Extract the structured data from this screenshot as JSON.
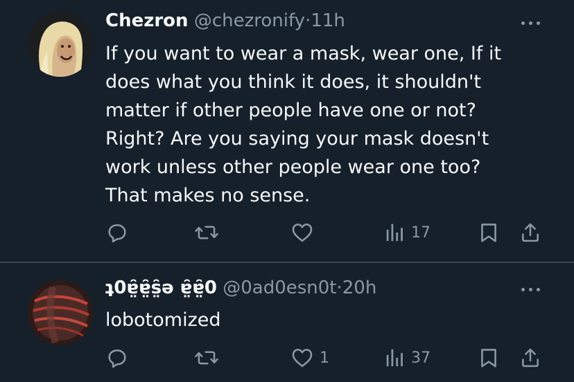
{
  "colors": {
    "background": "#15202b",
    "text_primary": "#f7f9f9",
    "text_secondary": "#8b98a5",
    "divider": "#38444d"
  },
  "tweets": [
    {
      "display_name": "Chezron",
      "handle": "@chezronify",
      "separator": "·",
      "time": "11h",
      "text": "If you want to wear a mask, wear one, If it\ndoes what you think it does, it shouldn't\nmatter if other people have one or not?\nRight? Are you saying your mask doesn't\nwork unless other people wear one too?\nThat makes no sense.",
      "reply_count": "",
      "retweet_count": "",
      "like_count": "",
      "view_count": "17",
      "icons": [
        "reply-icon",
        "retweet-icon",
        "like-icon",
        "views-icon",
        "bookmark-icon",
        "share-icon",
        "more-icon"
      ]
    },
    {
      "display_name": "ʇ0ɐ̤̑ɐ̤̑s̤̑ǝ ɐ̤̑ɐ̤̑0",
      "handle": "@0ad0esn0t",
      "separator": "·",
      "time": "20h",
      "text": "lobotomized",
      "reply_count": "",
      "retweet_count": "",
      "like_count": "1",
      "view_count": "37",
      "icons": [
        "reply-icon",
        "retweet-icon",
        "like-icon",
        "views-icon",
        "bookmark-icon",
        "share-icon",
        "more-icon"
      ]
    }
  ]
}
